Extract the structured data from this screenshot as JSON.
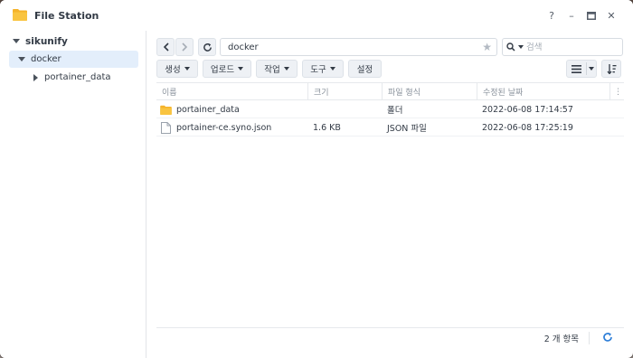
{
  "window": {
    "title": "File Station",
    "help": "?",
    "minimize": "–",
    "maximize": "□",
    "close": "✕"
  },
  "sidebar": {
    "root": "sikunify",
    "items": [
      {
        "label": "docker",
        "selected": true
      },
      {
        "label": "portainer_data",
        "selected": false
      }
    ]
  },
  "toolbar": {
    "back": "‹",
    "forward": "›",
    "refresh": "↻",
    "path": "docker",
    "search_placeholder": "검색",
    "create": "생성",
    "upload": "업로드",
    "action": "작업",
    "tools": "도구",
    "settings": "설정"
  },
  "table": {
    "headers": [
      "이름",
      "크기",
      "파일 형식",
      "수정된 날짜"
    ],
    "rows": [
      {
        "name": "portainer_data",
        "size": "",
        "type": "폴더",
        "modified": "2022-06-08 17:14:57",
        "icon": "folder-icon"
      },
      {
        "name": "portainer-ce.syno.json",
        "size": "1.6 KB",
        "type": "JSON 파일",
        "modified": "2022-06-08 17:25:19",
        "icon": "file-icon"
      }
    ]
  },
  "footer": {
    "count": "2 개 항목"
  },
  "colors": {
    "folder": "#f5b32a",
    "selected": "#e3eefb",
    "accent": "#2f7fd8"
  }
}
